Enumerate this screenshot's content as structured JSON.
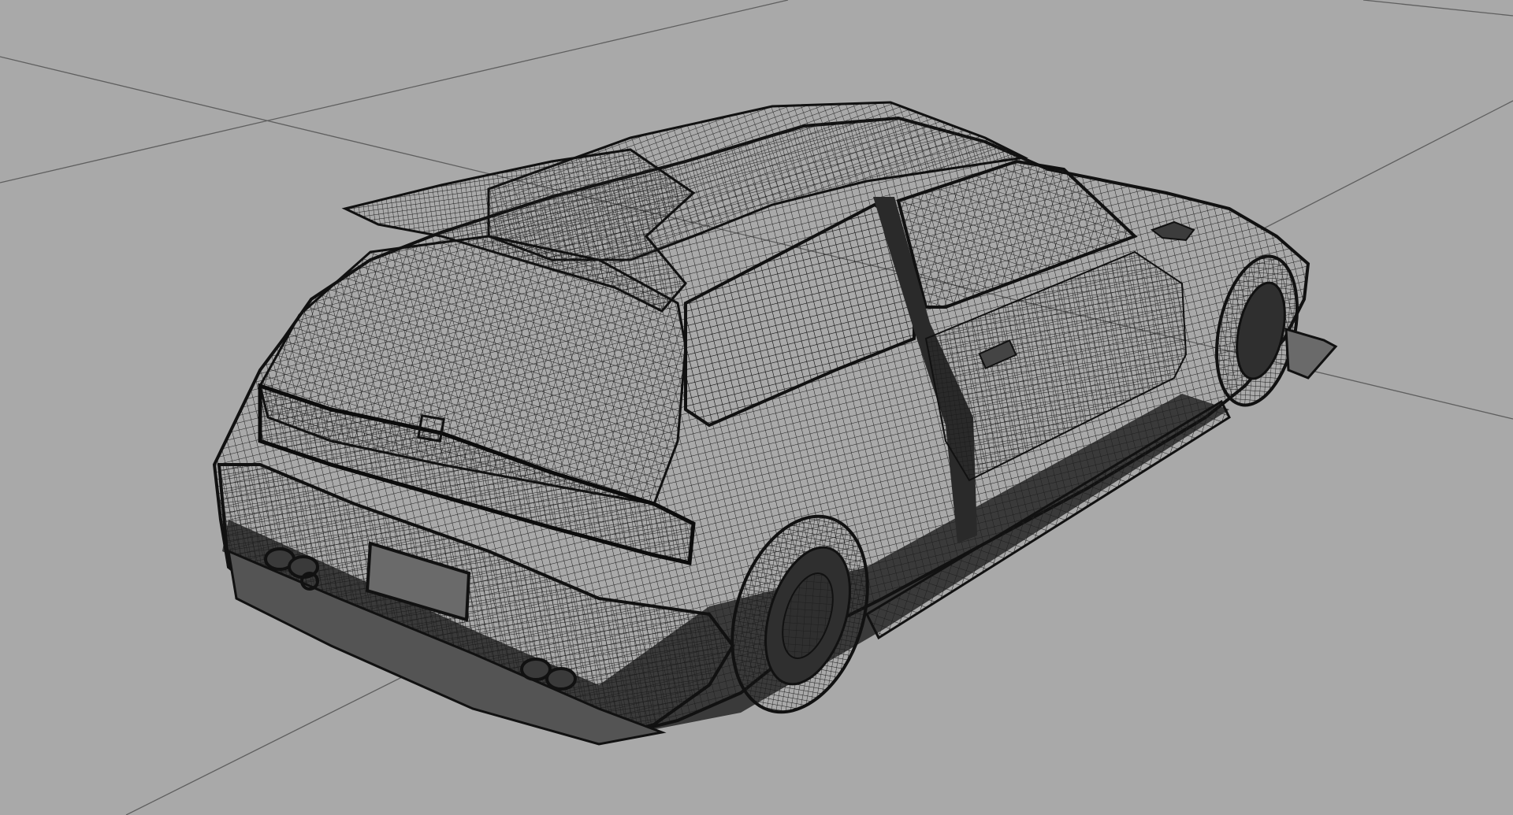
{
  "viewport": {
    "view": "perspective",
    "display_mode": "wireframe-on-shaded",
    "background_color": "#a9a9a9",
    "mesh_color": "#1e1e1e",
    "grid_color": "#5f5f5f",
    "hud_text": ""
  },
  "model": {
    "subject": "hatchback car",
    "parts": [
      "body",
      "roof",
      "rear-spoiler",
      "rear-window",
      "side-window",
      "door",
      "door-handle",
      "side-mirror",
      "side-skirt",
      "rear-bumper",
      "license-plate",
      "exhaust-pipes",
      "rear-wheel",
      "front-wheel",
      "front-splitter",
      "tail-lights",
      "badge"
    ]
  }
}
